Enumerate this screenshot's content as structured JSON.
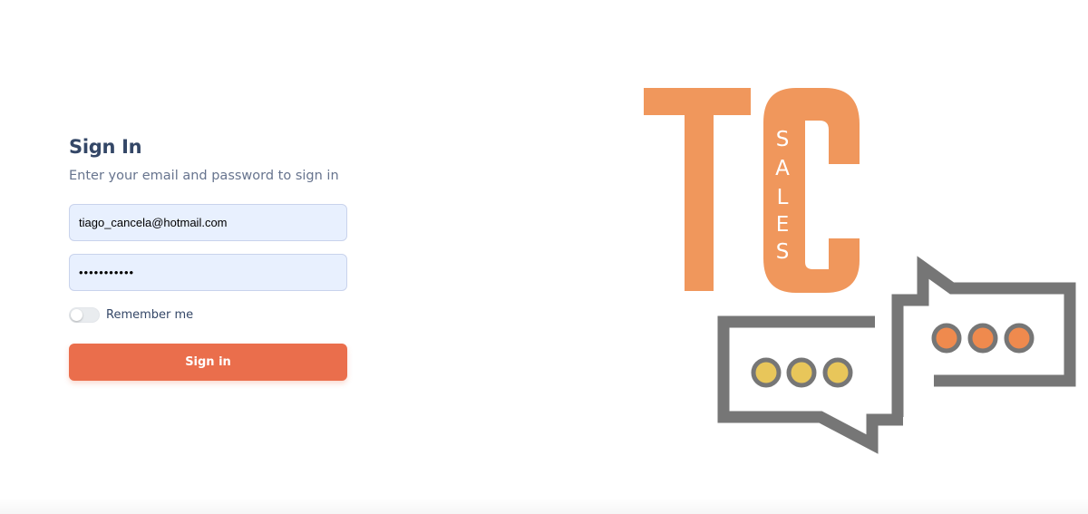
{
  "signin": {
    "title": "Sign In",
    "subtitle": "Enter your email and password to sign in",
    "email_value": "tiago_cancela@hotmail.com",
    "password_masked": "•••••••••••",
    "remember_label": "Remember me",
    "remember_checked": false,
    "button_label": "Sign in"
  },
  "logo": {
    "letters": "TC",
    "tagline": "SALES",
    "tagline_letters": [
      "S",
      "A",
      "L",
      "E",
      "S"
    ],
    "colors": {
      "brand_orange": "#f0975c",
      "bubble_gray": "#767676",
      "dot_yellow": "#e8c65a",
      "dot_orange": "#ef8a4e"
    }
  },
  "theme": {
    "accent": "#ea6e4c",
    "input_bg": "#e8f0fe",
    "heading": "#344767",
    "muted": "#67748e"
  }
}
